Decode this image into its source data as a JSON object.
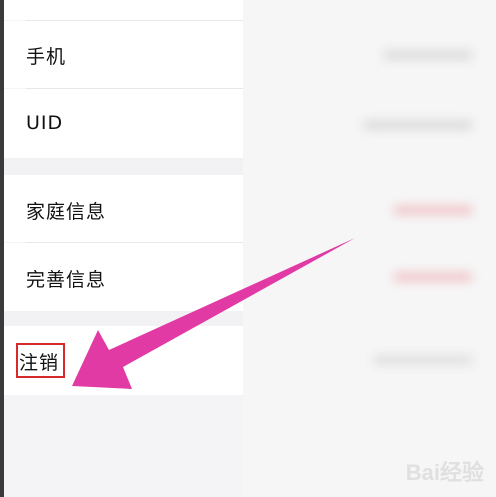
{
  "settings": {
    "items": [
      {
        "label": "手机"
      },
      {
        "label": "UID"
      },
      {
        "label": "家庭信息"
      },
      {
        "label": "完善信息"
      },
      {
        "label": "注销"
      }
    ]
  },
  "colors": {
    "arrow": "#e040a0",
    "highlight": "#d72b2b"
  },
  "watermark": "Bai经验"
}
